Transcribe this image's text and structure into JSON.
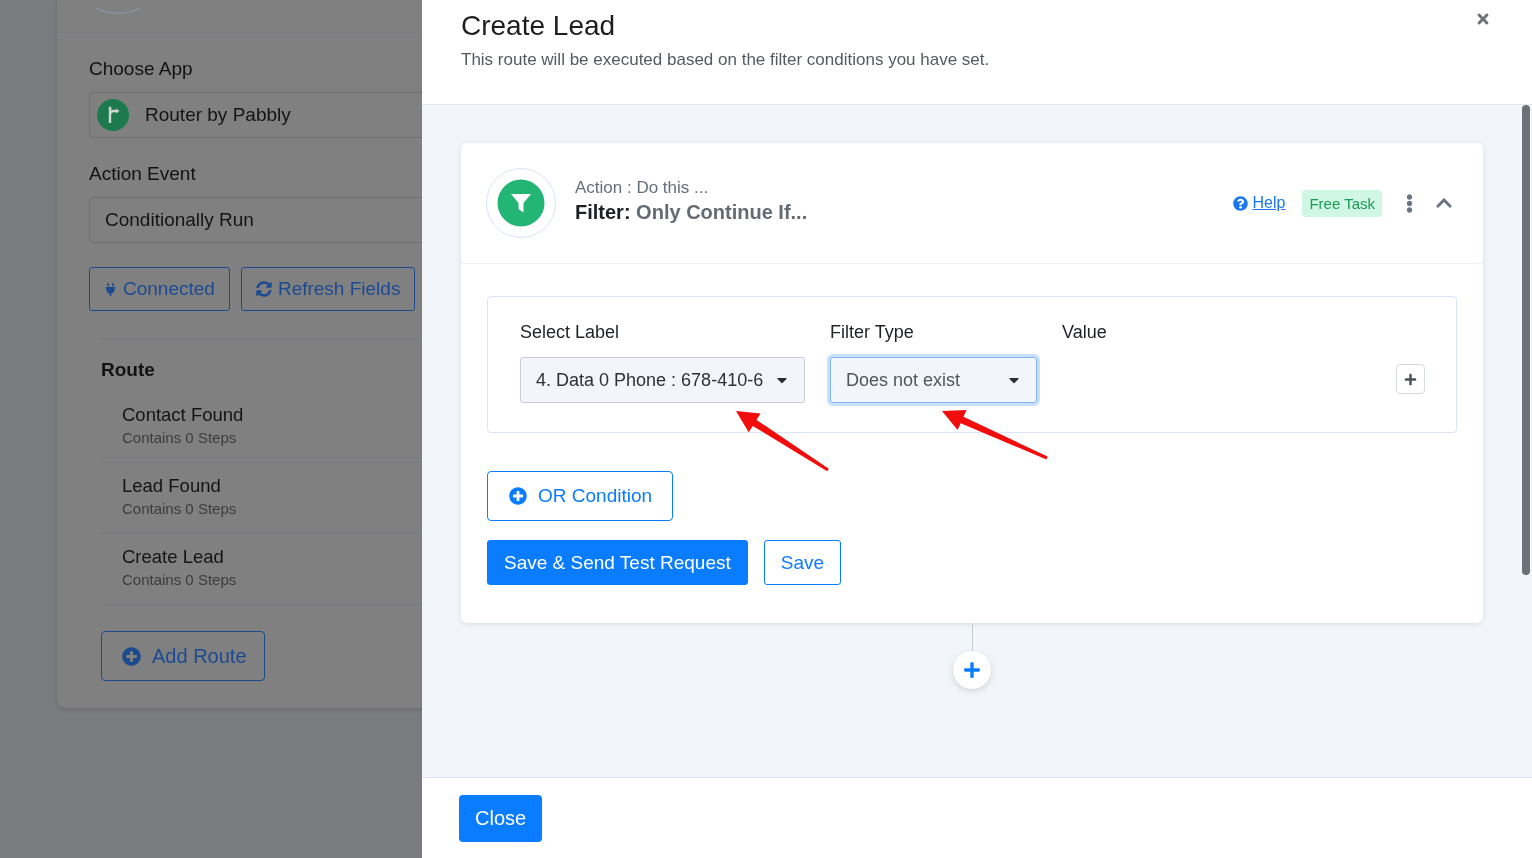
{
  "background_page": {
    "sections": [
      {
        "kind": "app",
        "label": "Choose App",
        "value": "Router by Pabbly"
      },
      {
        "kind": "event",
        "label": "Action Event",
        "value": "Conditionally Run"
      }
    ],
    "buttons": [
      {
        "kind": "plug",
        "label": "Connected"
      },
      {
        "kind": "refresh",
        "label": "Refresh Fields"
      }
    ],
    "route": {
      "title": "Route",
      "items": [
        {
          "name": "Contact Found",
          "steps": "Contains 0 Steps"
        },
        {
          "name": "Lead Found",
          "steps": "Contains 0 Steps"
        },
        {
          "name": "Create Lead",
          "steps": "Contains 0 Steps"
        }
      ],
      "add_button": "Add Route"
    }
  },
  "modal": {
    "title": "Create Lead",
    "subtitle": "This route will be executed based on the filter conditions you have set.",
    "step": {
      "caption": "Action : Do this ...",
      "name": "**Filter:** Only Continue If...",
      "help": "Help",
      "badge": "Free Task",
      "expanded": true,
      "condition": {
        "fields": [
          {
            "kind": "select",
            "label": "Select Label",
            "value": "4. Data 0 Phone : 678-410-6",
            "focused": false
          },
          {
            "kind": "select",
            "label": "Filter Type",
            "value": "Does not exist",
            "focused": true
          },
          {
            "kind": "empty",
            "label": "Value"
          }
        ]
      },
      "or_button": "OR Condition",
      "actions": [
        {
          "kind": "primary",
          "label": "Save & Send Test Request"
        },
        {
          "kind": "outline",
          "label": "Save"
        }
      ]
    },
    "footer": {
      "button": "Close"
    }
  }
}
